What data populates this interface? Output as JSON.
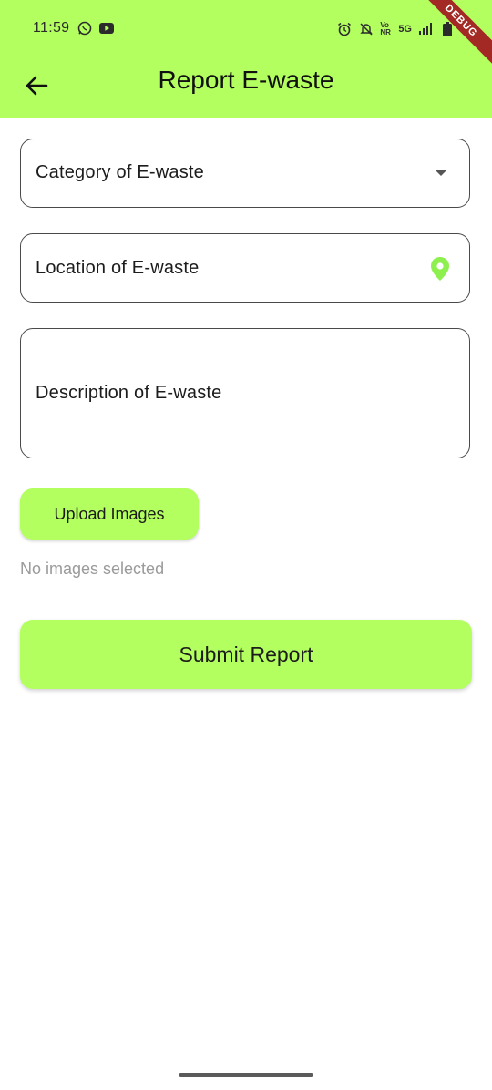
{
  "status_bar": {
    "time": "11:59",
    "network": "5G",
    "volte": "Vo NR",
    "icons_left": [
      "whatsapp-icon",
      "youtube-icon"
    ],
    "icons_right": [
      "alarm-icon",
      "mute-icon",
      "signal-icon",
      "battery-icon"
    ]
  },
  "debug_banner": "DEBUG",
  "app_bar": {
    "title": "Report E-waste",
    "back_icon": "arrow-back-icon"
  },
  "form": {
    "category_label": "Category of E-waste",
    "location_label": "Location of E-waste",
    "description_label": "Description of E-waste",
    "upload_button": "Upload Images",
    "images_status": "No images selected",
    "submit_button": "Submit Report"
  },
  "colors": {
    "accent": "#b3ff5f",
    "location_pin": "#8ef04f",
    "border": "#4a4a4a",
    "muted_text": "#9a9a9a"
  }
}
